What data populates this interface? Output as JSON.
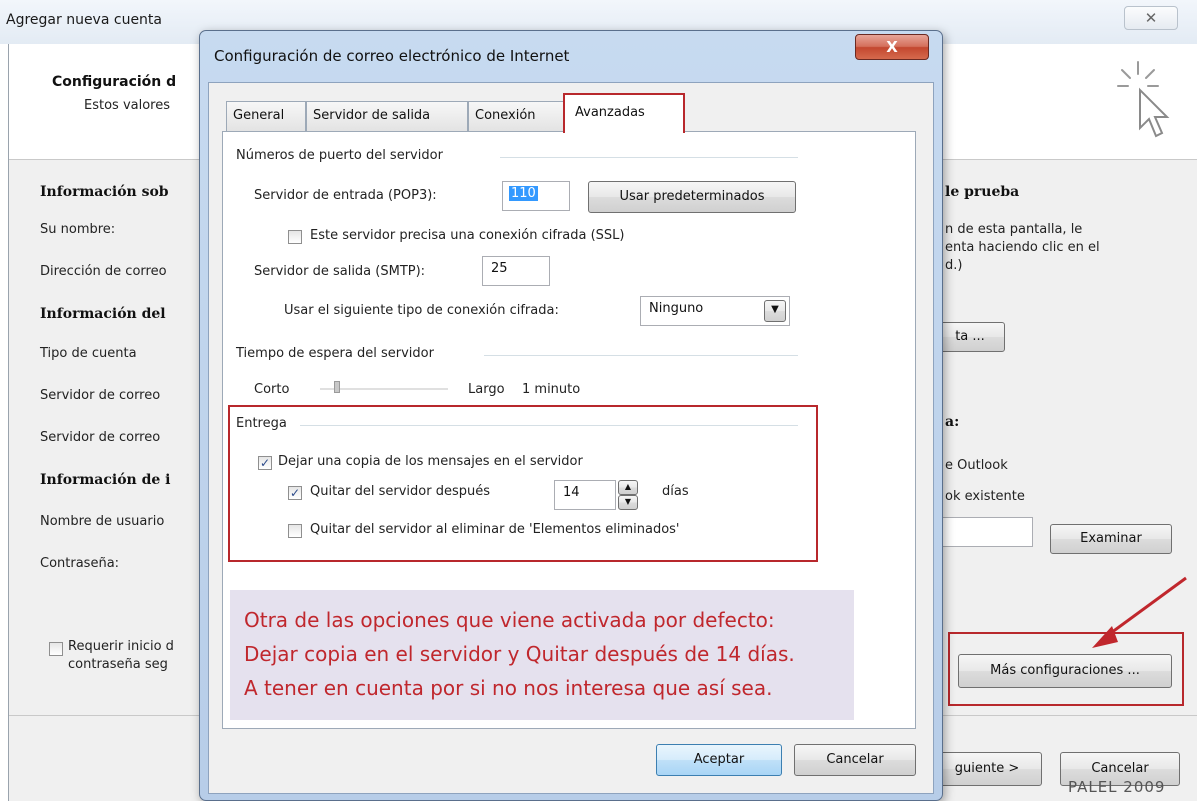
{
  "background_window": {
    "title": "Agregar nueva cuenta",
    "close_glyph": "✕",
    "header": {
      "title": "Configuración d",
      "subtitle": "Estos valores"
    },
    "left": {
      "section_user": "Información sob",
      "su_nombre": "Su nombre:",
      "direccion": "Dirección de correo",
      "section_server": "Información del",
      "tipo_cuenta": "Tipo de cuenta",
      "servidor_correo_1": "Servidor de correo",
      "servidor_correo_2": "Servidor de correo",
      "section_login": "Información de i",
      "nombre_usuario": "Nombre de usuario",
      "contrasena": "Contraseña:",
      "requerir_1": "Requerir inicio d",
      "requerir_2": "contraseña seg"
    },
    "right": {
      "section_test": "le prueba",
      "test_text_1": "n de esta pantalla, le",
      "test_text_2": "enta haciendo clic en el",
      "test_text_3": "d.)",
      "probar_button": "ta ...",
      "section_deliver": "a:",
      "outlook_1": "e Outlook",
      "outlook_2": "ok existente",
      "examinar_button": "Examinar",
      "mas_config_button": "Más configuraciones ..."
    },
    "footer": {
      "siguiente_button": "guiente >",
      "cancelar_button": "Cancelar",
      "watermark": "PALEL 2009"
    }
  },
  "dialog": {
    "title": "Configuración de correo electrónico de Internet",
    "close_glyph": "X",
    "tabs": [
      {
        "label": "General"
      },
      {
        "label": "Servidor de salida"
      },
      {
        "label": "Conexión"
      },
      {
        "label": "Avanzadas"
      }
    ],
    "ports_group": "Números de puerto del servidor",
    "incoming_label": "Servidor de entrada (POP3):",
    "incoming_value": "110",
    "defaults_button": "Usar predeterminados",
    "ssl_label": "Este servidor precisa una conexión cifrada (SSL)",
    "outgoing_label": "Servidor de salida (SMTP):",
    "outgoing_value": "25",
    "encryption_label": "Usar el siguiente tipo de conexión cifrada:",
    "encryption_value": "Ninguno",
    "timeout_group": "Tiempo de espera del servidor",
    "timeout_short": "Corto",
    "timeout_long": "Largo",
    "timeout_value": "1 minuto",
    "delivery_group": "Entrega",
    "leave_copy_label": "Dejar una copia de los mensajes en el servidor",
    "remove_after_label": "Quitar del servidor después",
    "remove_after_days": "14",
    "days_label": "días",
    "remove_deleted_label": "Quitar del servidor al eliminar de 'Elementos eliminados'",
    "ok_button": "Aceptar",
    "cancel_button": "Cancelar"
  },
  "annotation": {
    "line1": "Otra de las opciones que viene activada por defecto:",
    "line2": "Dejar copia en el servidor y Quitar después de 14 días.",
    "line3": "A tener en cuenta por si no nos interesa que así sea."
  },
  "colors": {
    "highlight": "#b8282c",
    "note_text": "#c0272d",
    "note_bg": "#e5e1ee"
  }
}
